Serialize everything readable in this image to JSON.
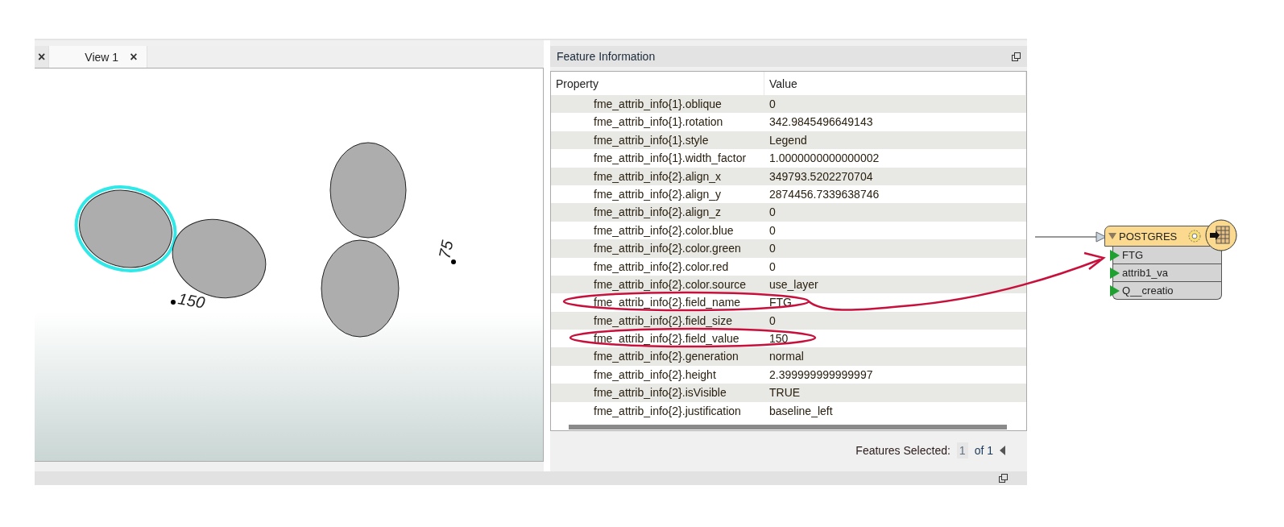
{
  "view_tabs": [
    {
      "close": "×",
      "selected": false
    },
    {
      "label": "View 1",
      "close": "×",
      "selected": true
    }
  ],
  "map": {
    "features": [
      {
        "selected": true
      },
      {
        "selected": false
      },
      {
        "selected": false
      },
      {
        "selected": false
      }
    ],
    "labels": [
      "150",
      "75"
    ]
  },
  "feature_information": {
    "title": "Feature Information",
    "columns": [
      "Property",
      "Value"
    ],
    "rows": [
      {
        "property": "fme_attrib_info{1}.oblique",
        "value": "0"
      },
      {
        "property": "fme_attrib_info{1}.rotation",
        "value": "342.9845496649143"
      },
      {
        "property": "fme_attrib_info{1}.style",
        "value": "Legend"
      },
      {
        "property": "fme_attrib_info{1}.width_factor",
        "value": "1.0000000000000002"
      },
      {
        "property": "fme_attrib_info{2}.align_x",
        "value": "349793.5202270704"
      },
      {
        "property": "fme_attrib_info{2}.align_y",
        "value": "2874456.7339638746"
      },
      {
        "property": "fme_attrib_info{2}.align_z",
        "value": "0"
      },
      {
        "property": "fme_attrib_info{2}.color.blue",
        "value": "0"
      },
      {
        "property": "fme_attrib_info{2}.color.green",
        "value": "0"
      },
      {
        "property": "fme_attrib_info{2}.color.red",
        "value": "0"
      },
      {
        "property": "fme_attrib_info{2}.color.source",
        "value": "use_layer"
      },
      {
        "property": "fme_attrib_info{2}.field_name",
        "value": "FTG"
      },
      {
        "property": "fme_attrib_info{2}.field_size",
        "value": "0"
      },
      {
        "property": "fme_attrib_info{2}.field_value",
        "value": "150"
      },
      {
        "property": "fme_attrib_info{2}.generation",
        "value": "normal"
      },
      {
        "property": "fme_attrib_info{2}.height",
        "value": "2.399999999999997"
      },
      {
        "property": "fme_attrib_info{2}.isVisible",
        "value": "TRUE"
      },
      {
        "property": "fme_attrib_info{2}.justification",
        "value": "baseline_left"
      }
    ],
    "footer": {
      "label": "Features Selected:",
      "current": "1",
      "total": "of 1"
    }
  },
  "writer_node": {
    "title": "POSTGRES",
    "ports": [
      "FTG",
      "attrib1_va",
      "Q__creatio"
    ]
  }
}
